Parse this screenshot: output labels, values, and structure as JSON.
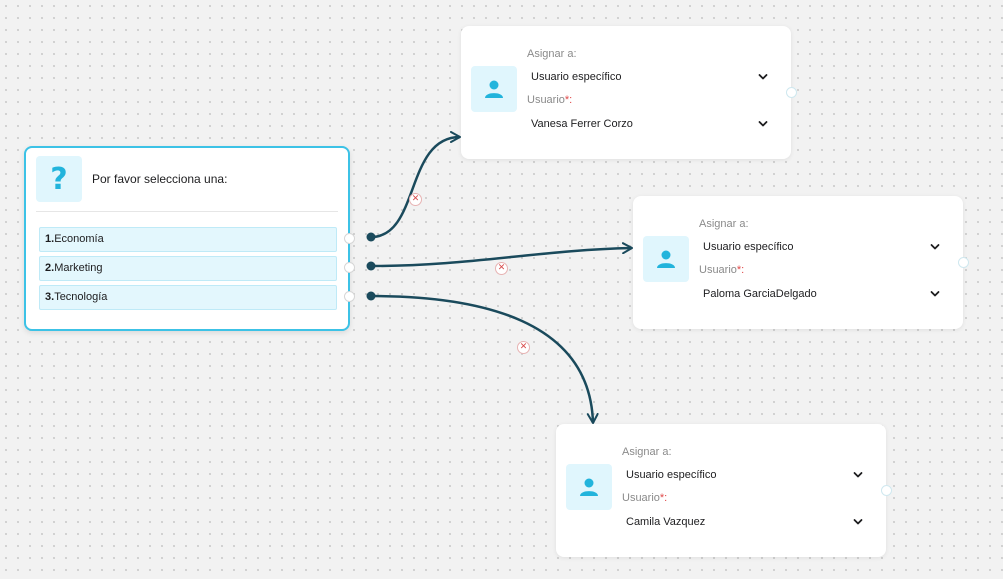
{
  "question": {
    "icon": "question-icon",
    "title": "Por favor selecciona una:",
    "options": [
      {
        "num": "1.",
        "label": "Economía"
      },
      {
        "num": "2.",
        "label": "Marketing"
      },
      {
        "num": "3.",
        "label": "Tecnología"
      }
    ]
  },
  "assign_nodes": [
    {
      "icon": "user-icon",
      "assign_label": "Asignar a:",
      "assign_value": "Usuario específico",
      "user_label": "Usuario",
      "required_mark": "*:",
      "user_value": "Vanesa Ferrer Corzo"
    },
    {
      "icon": "user-icon",
      "assign_label": "Asignar a:",
      "assign_value": "Usuario específico",
      "user_label": "Usuario",
      "required_mark": "*:",
      "user_value": "Paloma GarciaDelgado"
    },
    {
      "icon": "user-icon",
      "assign_label": "Asignar a:",
      "assign_value": "Usuario específico",
      "user_label": "Usuario",
      "required_mark": "*:",
      "user_value": "Camila Vazquez"
    }
  ],
  "colors": {
    "connector": "#1a4a5c",
    "accent": "#3cc2e6",
    "icon": "#22b4dc",
    "delete": "#d84a4a"
  }
}
